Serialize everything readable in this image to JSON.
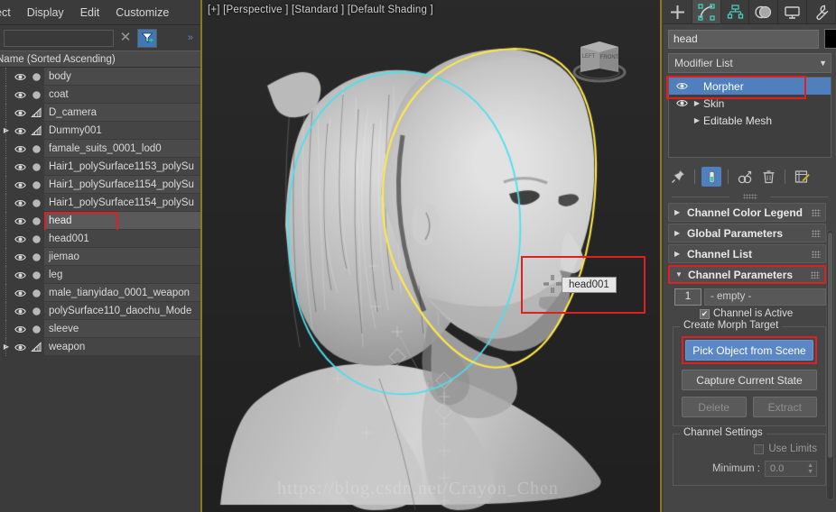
{
  "menubar": {
    "items": [
      {
        "label": "ect",
        "clipped": true
      },
      {
        "label": "Display",
        "clipped": false
      },
      {
        "label": "Edit",
        "clipped": false
      },
      {
        "label": "Customize",
        "clipped": false
      }
    ]
  },
  "explorer": {
    "search": {
      "value": "",
      "placeholder": ""
    },
    "clear_label": "✕",
    "filter_icon": "filter-icon",
    "more_label": "»",
    "column_header": "Name (Sorted Ascending)",
    "nodes": [
      {
        "name": "body",
        "type": "mesh",
        "expandable": false,
        "selected": false
      },
      {
        "name": "coat",
        "type": "mesh",
        "expandable": false,
        "selected": false
      },
      {
        "name": "D_camera",
        "type": "helper",
        "expandable": false,
        "selected": false
      },
      {
        "name": "Dummy001",
        "type": "helper",
        "expandable": true,
        "selected": false
      },
      {
        "name": "famale_suits_0001_lod0",
        "type": "mesh",
        "expandable": false,
        "selected": false
      },
      {
        "name": "Hair1_polySurface1153_polySu",
        "type": "mesh",
        "expandable": false,
        "selected": false
      },
      {
        "name": "Hair1_polySurface1154_polySu",
        "type": "mesh",
        "expandable": false,
        "selected": false
      },
      {
        "name": "Hair1_polySurface1154_polySu",
        "type": "mesh",
        "expandable": false,
        "selected": false
      },
      {
        "name": "head",
        "type": "mesh",
        "expandable": false,
        "selected": true
      },
      {
        "name": "head001",
        "type": "mesh",
        "expandable": false,
        "selected": false
      },
      {
        "name": "jiemao",
        "type": "mesh",
        "expandable": false,
        "selected": false
      },
      {
        "name": "leg",
        "type": "mesh",
        "expandable": false,
        "selected": false
      },
      {
        "name": "male_tianyidao_0001_weapon",
        "type": "mesh",
        "expandable": false,
        "selected": false
      },
      {
        "name": "polySurface110_daochu_Mode",
        "type": "mesh",
        "expandable": false,
        "selected": false
      },
      {
        "name": "sleeve",
        "type": "mesh",
        "expandable": false,
        "selected": false
      },
      {
        "name": "weapon",
        "type": "helper",
        "expandable": true,
        "selected": false
      }
    ]
  },
  "viewport": {
    "label": "[+] [Perspective ] [Standard ] [Default Shading ]",
    "viewcube": {
      "face_left": "LEFT",
      "face_front": "FRONT"
    },
    "tooltip": "head001",
    "selection_outline_color": "#ffe84a",
    "hover_outline_color": "#4ce0ee",
    "highlight_box_color": "#e02020"
  },
  "command_panel": {
    "tabs": [
      {
        "name": "create",
        "icon": "plus-icon",
        "active": false
      },
      {
        "name": "modify",
        "icon": "modify-curve-icon",
        "active": true
      },
      {
        "name": "hierarchy",
        "icon": "hierarchy-icon",
        "active": false
      },
      {
        "name": "motion",
        "icon": "motion-circles-icon",
        "active": false
      },
      {
        "name": "display",
        "icon": "display-monitor-icon",
        "active": false
      },
      {
        "name": "utilities",
        "icon": "wrench-icon",
        "active": false
      }
    ],
    "object_name": "head",
    "object_color": "#000000",
    "modifier_list_label": "Modifier List",
    "stack": [
      {
        "label": "Morpher",
        "active": true,
        "has_eye": true,
        "expandable": false
      },
      {
        "label": "Skin",
        "active": false,
        "has_eye": true,
        "expandable": true
      },
      {
        "label": "Editable Mesh",
        "active": false,
        "has_eye": false,
        "expandable": true
      }
    ],
    "mod_toolbar": [
      {
        "name": "pin-stack-icon",
        "on": false
      },
      {
        "name": "show-end-result-icon",
        "on": true
      },
      {
        "name": "make-unique-icon",
        "on": false
      },
      {
        "name": "remove-modifier-icon",
        "on": false
      },
      {
        "name": "configure-sets-icon",
        "on": false
      }
    ],
    "rollouts": [
      {
        "label": "Channel Color Legend",
        "open": false,
        "highlighted": false
      },
      {
        "label": "Global Parameters",
        "open": false,
        "highlighted": false
      },
      {
        "label": "Channel List",
        "open": false,
        "highlighted": false
      },
      {
        "label": "Channel Parameters",
        "open": true,
        "highlighted": true
      }
    ],
    "channel": {
      "index": "1",
      "name": "- empty -",
      "active_label": "Channel is Active",
      "active_checked": true
    },
    "create_morph_target": {
      "title": "Create Morph Target",
      "pick_object": "Pick Object from Scene",
      "capture_state": "Capture Current State",
      "delete": "Delete",
      "extract": "Extract"
    },
    "channel_settings": {
      "title": "Channel Settings",
      "use_limits_label": "Use Limits",
      "use_limits_checked": false,
      "minimum_label": "Minimum :",
      "minimum_value": "0.0"
    }
  },
  "watermark": "https://blog.csdn.net/Crayon_Chen"
}
